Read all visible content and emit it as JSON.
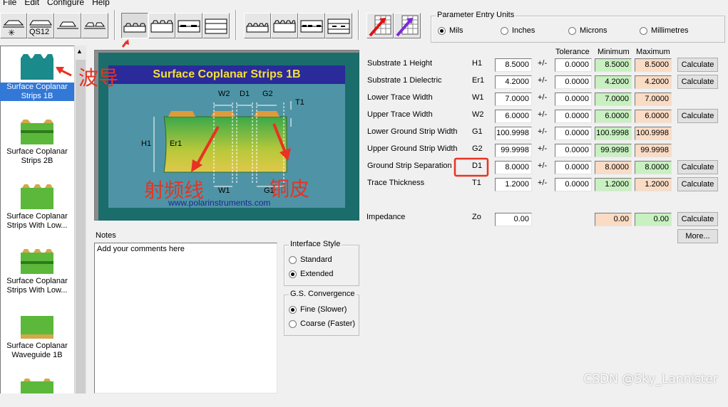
{
  "menu": [
    "File",
    "Edit",
    "Configure",
    "Help"
  ],
  "toolbar": {
    "qs12_label": "QS12"
  },
  "units": {
    "title": "Parameter Entry Units",
    "options": [
      "Mils",
      "Inches",
      "Microns",
      "Millimetres"
    ],
    "selected": "Mils"
  },
  "structures": [
    {
      "label": "Surface Coplanar Strips 1B",
      "selected": true
    },
    {
      "label": "Surface Coplanar Strips 2B",
      "selected": false
    },
    {
      "label": "Surface Coplanar Strips With Low...",
      "selected": false
    },
    {
      "label": "Surface Coplanar Strips With Low...",
      "selected": false
    },
    {
      "label": "Surface Coplanar Waveguide 1B",
      "selected": false
    }
  ],
  "diagram": {
    "title": "Surface Coplanar Strips 1B",
    "labels": {
      "w2": "W2",
      "d1": "D1",
      "g2": "G2",
      "t1": "T1",
      "h1": "H1",
      "er1": "Er1",
      "w1": "W1",
      "g1": "G1"
    },
    "url": "www.polarinstruments.com"
  },
  "columns": {
    "tolerance": "Tolerance",
    "minimum": "Minimum",
    "maximum": "Maximum"
  },
  "pm_symbol": "+/-",
  "params": [
    {
      "label": "Substrate 1 Height",
      "sym": "H1",
      "value": "8.5000",
      "tol": "0.0000",
      "min": "8.5000",
      "max": "8.5000",
      "min_color": "green",
      "max_color": "orange",
      "calc": "Calculate"
    },
    {
      "label": "Substrate 1 Dielectric",
      "sym": "Er1",
      "value": "4.2000",
      "tol": "0.0000",
      "min": "4.2000",
      "max": "4.2000",
      "min_color": "green",
      "max_color": "orange",
      "calc": "Calculate"
    },
    {
      "label": "Lower Trace Width",
      "sym": "W1",
      "value": "7.0000",
      "tol": "0.0000",
      "min": "7.0000",
      "max": "7.0000",
      "min_color": "green",
      "max_color": "orange",
      "calc": ""
    },
    {
      "label": "Upper Trace Width",
      "sym": "W2",
      "value": "6.0000",
      "tol": "0.0000",
      "min": "6.0000",
      "max": "6.0000",
      "min_color": "green",
      "max_color": "orange",
      "calc": "Calculate"
    },
    {
      "label": "Lower Ground Strip Width",
      "sym": "G1",
      "value": "100.9998",
      "tol": "0.0000",
      "min": "100.9998",
      "max": "100.9998",
      "min_color": "green",
      "max_color": "orange",
      "calc": ""
    },
    {
      "label": "Upper Ground Strip Width",
      "sym": "G2",
      "value": "99.9998",
      "tol": "0.0000",
      "min": "99.9998",
      "max": "99.9998",
      "min_color": "green",
      "max_color": "orange",
      "calc": ""
    },
    {
      "label": "Ground Strip Separation",
      "sym": "D1",
      "value": "8.0000",
      "tol": "0.0000",
      "min": "8.0000",
      "max": "8.0000",
      "min_color": "orange",
      "max_color": "green",
      "calc": "Calculate"
    },
    {
      "label": "Trace Thickness",
      "sym": "T1",
      "value": "1.2000",
      "tol": "0.0000",
      "min": "1.2000",
      "max": "1.2000",
      "min_color": "green",
      "max_color": "orange",
      "calc": "Calculate"
    }
  ],
  "impedance": {
    "label": "Impedance",
    "sym": "Zo",
    "value": "0.00",
    "min": "0.00",
    "max": "0.00",
    "calc": "Calculate",
    "more": "More..."
  },
  "notes": {
    "title": "Notes",
    "text": "Add your comments here"
  },
  "interface_style": {
    "title": "Interface Style",
    "options": [
      "Standard",
      "Extended"
    ],
    "selected": "Extended"
  },
  "gs_convergence": {
    "title": "G.S. Convergence",
    "options": [
      "Fine (Slower)",
      "Coarse (Faster)"
    ],
    "selected": "Fine (Slower)"
  },
  "annotations": {
    "waveguide": "波导",
    "rf_line": "射频线",
    "copper": "铜皮"
  },
  "watermark": "CSDN @Sky_Lannister",
  "colors": {
    "selection": "#3278d7",
    "green_field": "#c8f0c0",
    "orange_field": "#fadbc4",
    "annotation": "#e83223",
    "diagram_bg": "#1a6d6b",
    "title_bar": "#2a2a9a",
    "title_text": "#f5e038"
  }
}
